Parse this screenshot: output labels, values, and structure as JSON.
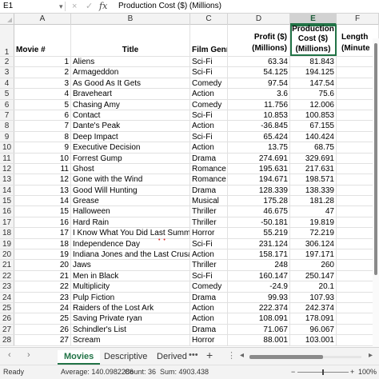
{
  "formula_bar": {
    "name_box": "E1",
    "caret": "▾",
    "cancel_icon": "×",
    "enter_icon": "✓",
    "fx_label": "fx",
    "content": "Production Cost ($) (Millions)"
  },
  "columns": [
    "A",
    "B",
    "C",
    "D",
    "E",
    "F"
  ],
  "selected_column": "E",
  "header_row": {
    "row_number": "1",
    "a": "Movie #",
    "b": "Title",
    "c": "Film Genre",
    "d1": "Profit ($)",
    "d2": "(Millions)",
    "e1": "Production",
    "e2": "Cost ($)",
    "e3": "(Millions)",
    "f1": "Length",
    "f2": "(Minute"
  },
  "rows": [
    {
      "rn": "2",
      "num": "1",
      "title": "Aliens",
      "genre": "Sci-Fi",
      "profit": "63.34",
      "cost": "81.843"
    },
    {
      "rn": "3",
      "num": "2",
      "title": "Armageddon",
      "genre": "Sci-Fi",
      "profit": "54.125",
      "cost": "194.125"
    },
    {
      "rn": "4",
      "num": "3",
      "title": "As Good As It Gets",
      "genre": "Comedy",
      "profit": "97.54",
      "cost": "147.54"
    },
    {
      "rn": "5",
      "num": "4",
      "title": "Braveheart",
      "genre": "Action",
      "profit": "3.6",
      "cost": "75.6"
    },
    {
      "rn": "6",
      "num": "5",
      "title": "Chasing Amy",
      "genre": "Comedy",
      "profit": "11.756",
      "cost": "12.006"
    },
    {
      "rn": "7",
      "num": "6",
      "title": "Contact",
      "genre": "Sci-Fi",
      "profit": "10.853",
      "cost": "100.853"
    },
    {
      "rn": "8",
      "num": "7",
      "title": "Dante's Peak",
      "genre": "Action",
      "profit": "-36.845",
      "cost": "67.155"
    },
    {
      "rn": "9",
      "num": "8",
      "title": "Deep Impact",
      "genre": "Sci-Fi",
      "profit": "65.424",
      "cost": "140.424"
    },
    {
      "rn": "10",
      "num": "9",
      "title": "Executive Decision",
      "genre": "Action",
      "profit": "13.75",
      "cost": "68.75"
    },
    {
      "rn": "11",
      "num": "10",
      "title": "Forrest Gump",
      "genre": "Drama",
      "profit": "274.691",
      "cost": "329.691"
    },
    {
      "rn": "12",
      "num": "11",
      "title": "Ghost",
      "genre": "Romance",
      "profit": "195.631",
      "cost": "217.631"
    },
    {
      "rn": "13",
      "num": "12",
      "title": "Gone with the Wind",
      "genre": "Romance",
      "profit": "194.671",
      "cost": "198.571"
    },
    {
      "rn": "14",
      "num": "13",
      "title": "Good Will Hunting",
      "genre": "Drama",
      "profit": "128.339",
      "cost": "138.339"
    },
    {
      "rn": "15",
      "num": "14",
      "title": "Grease",
      "genre": "Musical",
      "profit": "175.28",
      "cost": "181.28"
    },
    {
      "rn": "16",
      "num": "15",
      "title": "Halloween",
      "genre": "Thriller",
      "profit": "46.675",
      "cost": "47"
    },
    {
      "rn": "17",
      "num": "16",
      "title": "Hard Rain",
      "genre": "Thriller",
      "profit": "-50.181",
      "cost": "19.819"
    },
    {
      "rn": "18",
      "num": "17",
      "title": "I Know What You Did Last Summer",
      "genre": "Horror",
      "profit": "55.219",
      "cost": "72.219"
    },
    {
      "rn": "19",
      "num": "18",
      "title": "Independence Day",
      "genre": "Sci-Fi",
      "profit": "231.124",
      "cost": "306.124"
    },
    {
      "rn": "20",
      "num": "19",
      "title": "Indiana Jones and the Last Crusade",
      "genre": "Action",
      "profit": "158.171",
      "cost": "197.171"
    },
    {
      "rn": "21",
      "num": "20",
      "title": "Jaws",
      "genre": "Thriller",
      "profit": "248",
      "cost": "260"
    },
    {
      "rn": "22",
      "num": "21",
      "title": "Men in Black",
      "genre": "Sci-Fi",
      "profit": "160.147",
      "cost": "250.147"
    },
    {
      "rn": "23",
      "num": "22",
      "title": "Multiplicity",
      "genre": "Comedy",
      "profit": "-24.9",
      "cost": "20.1"
    },
    {
      "rn": "24",
      "num": "23",
      "title": "Pulp Fiction",
      "genre": "Drama",
      "profit": "99.93",
      "cost": "107.93"
    },
    {
      "rn": "25",
      "num": "24",
      "title": "Raiders of the Lost Ark",
      "genre": "Action",
      "profit": "222.374",
      "cost": "242.374"
    },
    {
      "rn": "26",
      "num": "25",
      "title": "Saving Private ryan",
      "genre": "Action",
      "profit": "108.091",
      "cost": "178.091"
    },
    {
      "rn": "27",
      "num": "26",
      "title": "Schindler's List",
      "genre": "Drama",
      "profit": "71.067",
      "cost": "96.067"
    },
    {
      "rn": "28",
      "num": "27",
      "title": "Scream",
      "genre": "Horror",
      "profit": "88.001",
      "cost": "103.001"
    }
  ],
  "sheet_tabs": {
    "prev": "‹",
    "next": "›",
    "tabs": [
      "Movies",
      "Descriptive",
      "Derived"
    ],
    "active": "Movies",
    "more": "•••",
    "add": "+",
    "sep": "⋮",
    "scroll_left": "◂",
    "scroll_right": "▸"
  },
  "status_bar": {
    "mode": "Ready",
    "average": "Average: 140.0982286",
    "count": "Count: 36",
    "sum": "Sum: 4903.438",
    "zoom_minus": "−",
    "zoom_plus": "+",
    "zoom": "100%",
    "zoom_level_percent": 100
  },
  "colors": {
    "accent": "#217346",
    "header_bg": "#f3f3f3",
    "gridline": "#e1e1e1"
  }
}
